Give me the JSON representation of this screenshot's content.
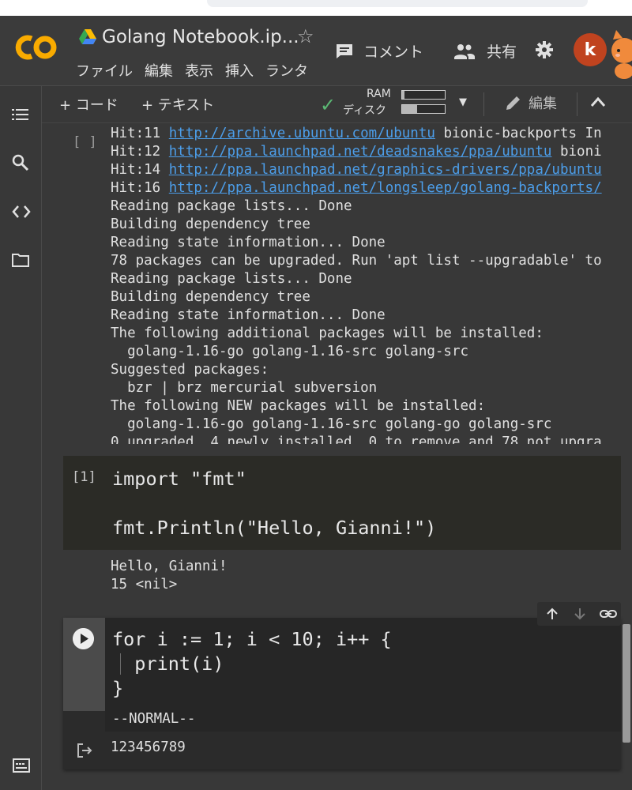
{
  "header": {
    "title": "Golang Notebook.ip...",
    "menu": [
      "ファイル",
      "編集",
      "表示",
      "挿入",
      "ランタ"
    ],
    "comment_label": "コメント",
    "share_label": "共有",
    "avatar_letter": "k",
    "logo_text": "CO"
  },
  "toolbar": {
    "add_code": "+ コード",
    "add_text": "+ テキスト",
    "ram_label": "RAM",
    "disk_label": "ディスク",
    "ram_fraction": 0.05,
    "disk_fraction": 0.35,
    "edit_label": "編集"
  },
  "cells": {
    "log": {
      "prompt": "[ ]",
      "lines": [
        {
          "t": "Hit:11 ",
          "u": "http://archive.ubuntu.com/ubuntu",
          "r": " bionic-backports In"
        },
        {
          "t": "Hit:12 ",
          "u": "http://ppa.launchpad.net/deadsnakes/ppa/ubuntu",
          "r": " bioni"
        },
        {
          "t": "Hit:14 ",
          "u": "http://ppa.launchpad.net/graphics-drivers/ppa/ubuntu",
          "r": ""
        },
        {
          "t": "Hit:16 ",
          "u": "http://ppa.launchpad.net/longsleep/golang-backports/",
          "r": ""
        },
        {
          "t": "Reading package lists... Done"
        },
        {
          "t": "Building dependency tree"
        },
        {
          "t": "Reading state information... Done"
        },
        {
          "t": "78 packages can be upgraded. Run 'apt list --upgradable' to"
        },
        {
          "t": "Reading package lists... Done"
        },
        {
          "t": "Building dependency tree"
        },
        {
          "t": "Reading state information... Done"
        },
        {
          "t": "The following additional packages will be installed:"
        },
        {
          "t": "  golang-1.16-go golang-1.16-src golang-src"
        },
        {
          "t": "Suggested packages:"
        },
        {
          "t": "  bzr | brz mercurial subversion"
        },
        {
          "t": "The following NEW packages will be installed:"
        },
        {
          "t": "  golang-1.16-go golang-1.16-src golang-go golang-src"
        },
        {
          "t": "0 upgraded, 4 newly installed, 0 to remove and 78 not upgra"
        }
      ]
    },
    "cell1": {
      "prompt": "[1]",
      "code_line1": "import \"fmt\"",
      "code_line2": "",
      "code_line3": "fmt.Println(\"Hello, Gianni!\")",
      "output_line1": "Hello, Gianni!",
      "output_line2": "15 <nil>"
    },
    "cell2": {
      "code_line1": "for i := 1; i < 10; i++ {",
      "code_line2": "  print(i)",
      "code_line3": "}",
      "status": "--NORMAL--",
      "output": "123456789"
    }
  }
}
